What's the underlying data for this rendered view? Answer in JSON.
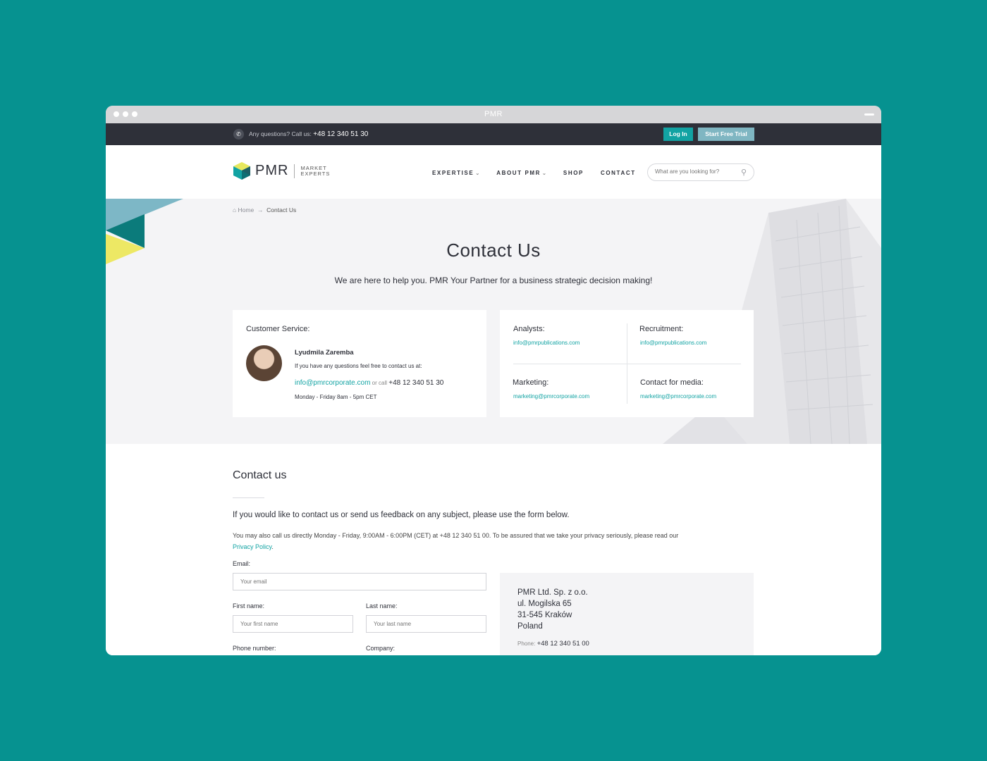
{
  "window": {
    "title": "PMR"
  },
  "topbar": {
    "question": "Any questions? Call us:",
    "phone": "+48 12 340 51 30",
    "login": "Log In",
    "trial": "Start Free Trial"
  },
  "header": {
    "logo_word": "PMR",
    "logo_sub_1": "MARKET",
    "logo_sub_2": "EXPERTS",
    "nav": [
      "EXPERTISE",
      "ABOUT PMR",
      "SHOP",
      "CONTACT"
    ],
    "search_placeholder": "What are you looking for?"
  },
  "breadcrumb": {
    "home": "Home",
    "arrow": "→",
    "current": "Contact Us"
  },
  "hero": {
    "title": "Contact Us",
    "subtitle": "We are here to help you. PMR Your Partner for a business strategic decision making!"
  },
  "customer_service": {
    "heading": "Customer Service:",
    "name": "Lyudmila Zaremba",
    "desc": "If you have any questions feel free to contact us at:",
    "email": "info@pmrcorporate.com",
    "or_call": "or call",
    "phone": "+48 12 340 51 30",
    "hours": "Monday - Friday 8am - 5pm CET"
  },
  "departments": [
    {
      "name": "Analysts:",
      "email": "info@pmrpublications.com"
    },
    {
      "name": "Recruitment:",
      "email": "info@pmrpublications.com"
    },
    {
      "name": "Marketing:",
      "email": "marketing@pmrcorporate.com"
    },
    {
      "name": "Contact for media:",
      "email": "marketing@pmrcorporate.com"
    }
  ],
  "contact_form": {
    "heading": "Contact us",
    "lead": "If you would like to contact us or send us feedback on any subject, please use the form below.",
    "para": "You may also call us directly Monday - Friday, 9:00AM - 6:00PM (CET) at +48 12 340 51 00. To be assured that we take your privacy seriously, please read our",
    "privacy": "Privacy Policy",
    "period": ".",
    "email_label": "Email:",
    "email_placeholder": "Your email",
    "first_label": "First name:",
    "first_placeholder": "Your first name",
    "last_label": "Last name:",
    "last_placeholder": "Your last name",
    "phone_label": "Phone number:",
    "company_label": "Company:"
  },
  "address": {
    "line1": "PMR Ltd. Sp. z o.o.",
    "line2": "ul. Mogilska 65",
    "line3": "31-545 Kraków",
    "line4": "Poland",
    "phone_label": "Phone:",
    "phone": "+48 12 340 51 00"
  },
  "colors": {
    "background": "#069290",
    "accent": "#12a3a3",
    "topbar": "#2e3039",
    "trial_button": "#7fb6c2"
  }
}
